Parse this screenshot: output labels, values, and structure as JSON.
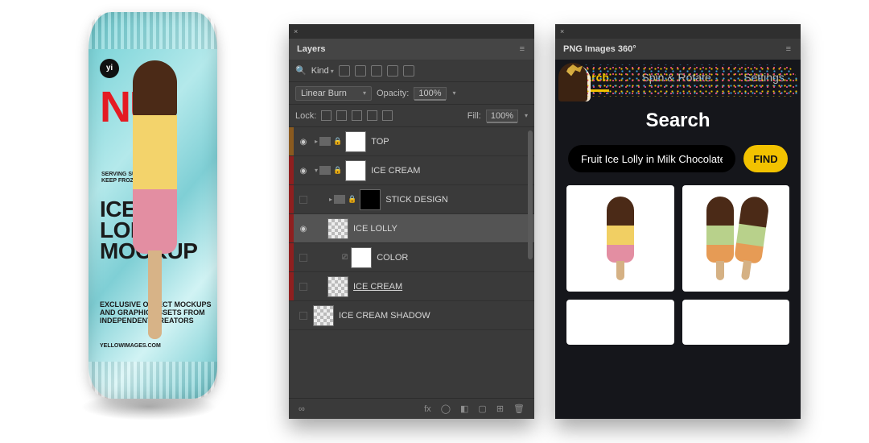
{
  "package": {
    "logo_text": "yi",
    "red_text": "NU",
    "small_line1": "SERVING SUGGESTION",
    "small_line2": "KEEP FROZEN",
    "title_line1": "ICE",
    "title_line2": "LOLLY",
    "title_line3": "MOCKUP",
    "body_text": "EXCLUSIVE OBJECT MOCKUPS AND GRAPHIC ASSETS FROM INDEPENDENT CREATORS",
    "site": "YELLOWIMAGES.COM"
  },
  "layers_panel": {
    "tab_label": "Layers",
    "menu_glyph": "≡",
    "close_glyph": "×",
    "kind_label": "Kind",
    "blend_mode": "Linear Burn",
    "opacity_label": "Opacity:",
    "opacity_value": "100%",
    "lock_label": "Lock:",
    "fill_label": "Fill:",
    "fill_value": "100%",
    "layers": [
      {
        "name": "TOP",
        "visible": true,
        "accent": "#8a5a1f",
        "type": "group",
        "indent": 0,
        "thumb": "white",
        "selected": false
      },
      {
        "name": "ICE CREAM",
        "visible": true,
        "accent": "#8f1f1f",
        "type": "group",
        "indent": 0,
        "thumb": "white",
        "selected": false,
        "open": true
      },
      {
        "name": "STICK DESIGN",
        "visible": false,
        "accent": "#8f1f1f",
        "type": "group",
        "indent": 1,
        "thumb": "black",
        "selected": false
      },
      {
        "name": "ICE LOLLY",
        "visible": true,
        "accent": "#8f1f1f",
        "type": "smart",
        "indent": 1,
        "thumb": "check",
        "selected": true
      },
      {
        "name": "COLOR",
        "visible": false,
        "accent": "#8f1f1f",
        "type": "adjust",
        "indent": 2,
        "thumb": "white",
        "selected": false
      },
      {
        "name": "ICE CREAM",
        "visible": false,
        "accent": "#8f1f1f",
        "type": "smart",
        "indent": 1,
        "thumb": "check",
        "selected": false,
        "underline": true
      },
      {
        "name": "ICE CREAM SHADOW",
        "visible": false,
        "accent": "",
        "type": "smart",
        "indent": 0,
        "thumb": "check",
        "selected": false
      }
    ],
    "bottom_icons": [
      "∞",
      "fx",
      "◯",
      "◧",
      "▢",
      "⊞",
      "🗑"
    ]
  },
  "plugin_panel": {
    "title": "PNG Images 360°",
    "menu_glyph": "≡",
    "close_glyph": "×",
    "tabs": [
      {
        "label": "Search",
        "active": true
      },
      {
        "label": "Spin & Rotate",
        "active": false
      },
      {
        "label": "Settings",
        "active": false
      }
    ],
    "heading": "Search",
    "search_value": "Fruit Ice Lolly in Milk Chocolate",
    "find_label": "FIND",
    "results": [
      {
        "id": "result-fruit-lolly"
      },
      {
        "id": "result-green-orange-lolly"
      },
      {
        "id": "result-sprinkles-lolly"
      },
      {
        "id": "result-gold-choc-lolly"
      }
    ]
  }
}
